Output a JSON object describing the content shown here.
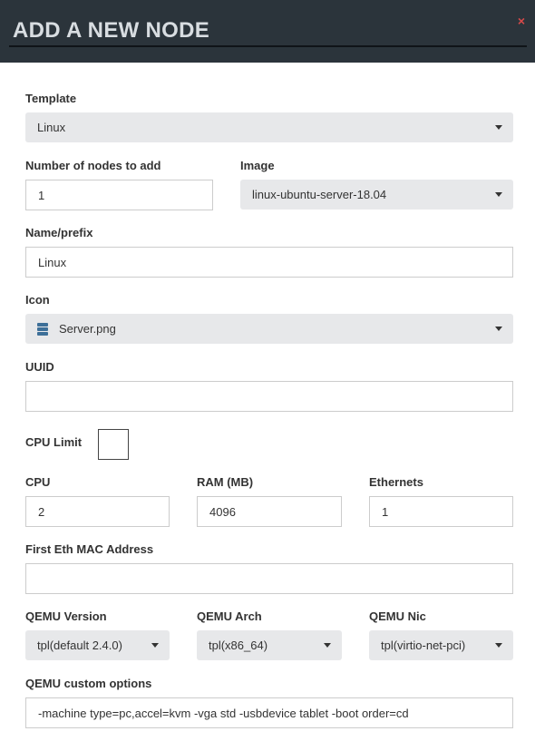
{
  "header": {
    "title": "ADD A NEW NODE",
    "close_glyph": "×"
  },
  "template": {
    "label": "Template",
    "value": "Linux"
  },
  "nodes_count": {
    "label": "Number of nodes to add",
    "value": "1"
  },
  "image": {
    "label": "Image",
    "value": "linux-ubuntu-server-18.04"
  },
  "name": {
    "label": "Name/prefix",
    "value": "Linux"
  },
  "icon": {
    "label": "Icon",
    "value": "Server.png",
    "icon_name": "server-icon"
  },
  "uuid": {
    "label": "UUID",
    "value": ""
  },
  "cpu_limit": {
    "label": "CPU Limit",
    "checked": false
  },
  "cpu": {
    "label": "CPU",
    "value": "2"
  },
  "ram": {
    "label": "RAM (MB)",
    "value": "4096"
  },
  "ethernets": {
    "label": "Ethernets",
    "value": "1"
  },
  "first_mac": {
    "label": "First Eth MAC Address",
    "value": ""
  },
  "qemu_version": {
    "label": "QEMU Version",
    "value": "tpl(default 2.4.0)"
  },
  "qemu_arch": {
    "label": "QEMU Arch",
    "value": "tpl(x86_64)"
  },
  "qemu_nic": {
    "label": "QEMU Nic",
    "value": "tpl(virtio-net-pci)"
  },
  "qemu_options": {
    "label": "QEMU custom options",
    "value": "-machine type=pc,accel=kvm -vga std -usbdevice tablet -boot order=cd"
  },
  "colors": {
    "header_bg": "#2b343b",
    "close": "#d84a4a",
    "select_bg": "#e7e8ea"
  }
}
